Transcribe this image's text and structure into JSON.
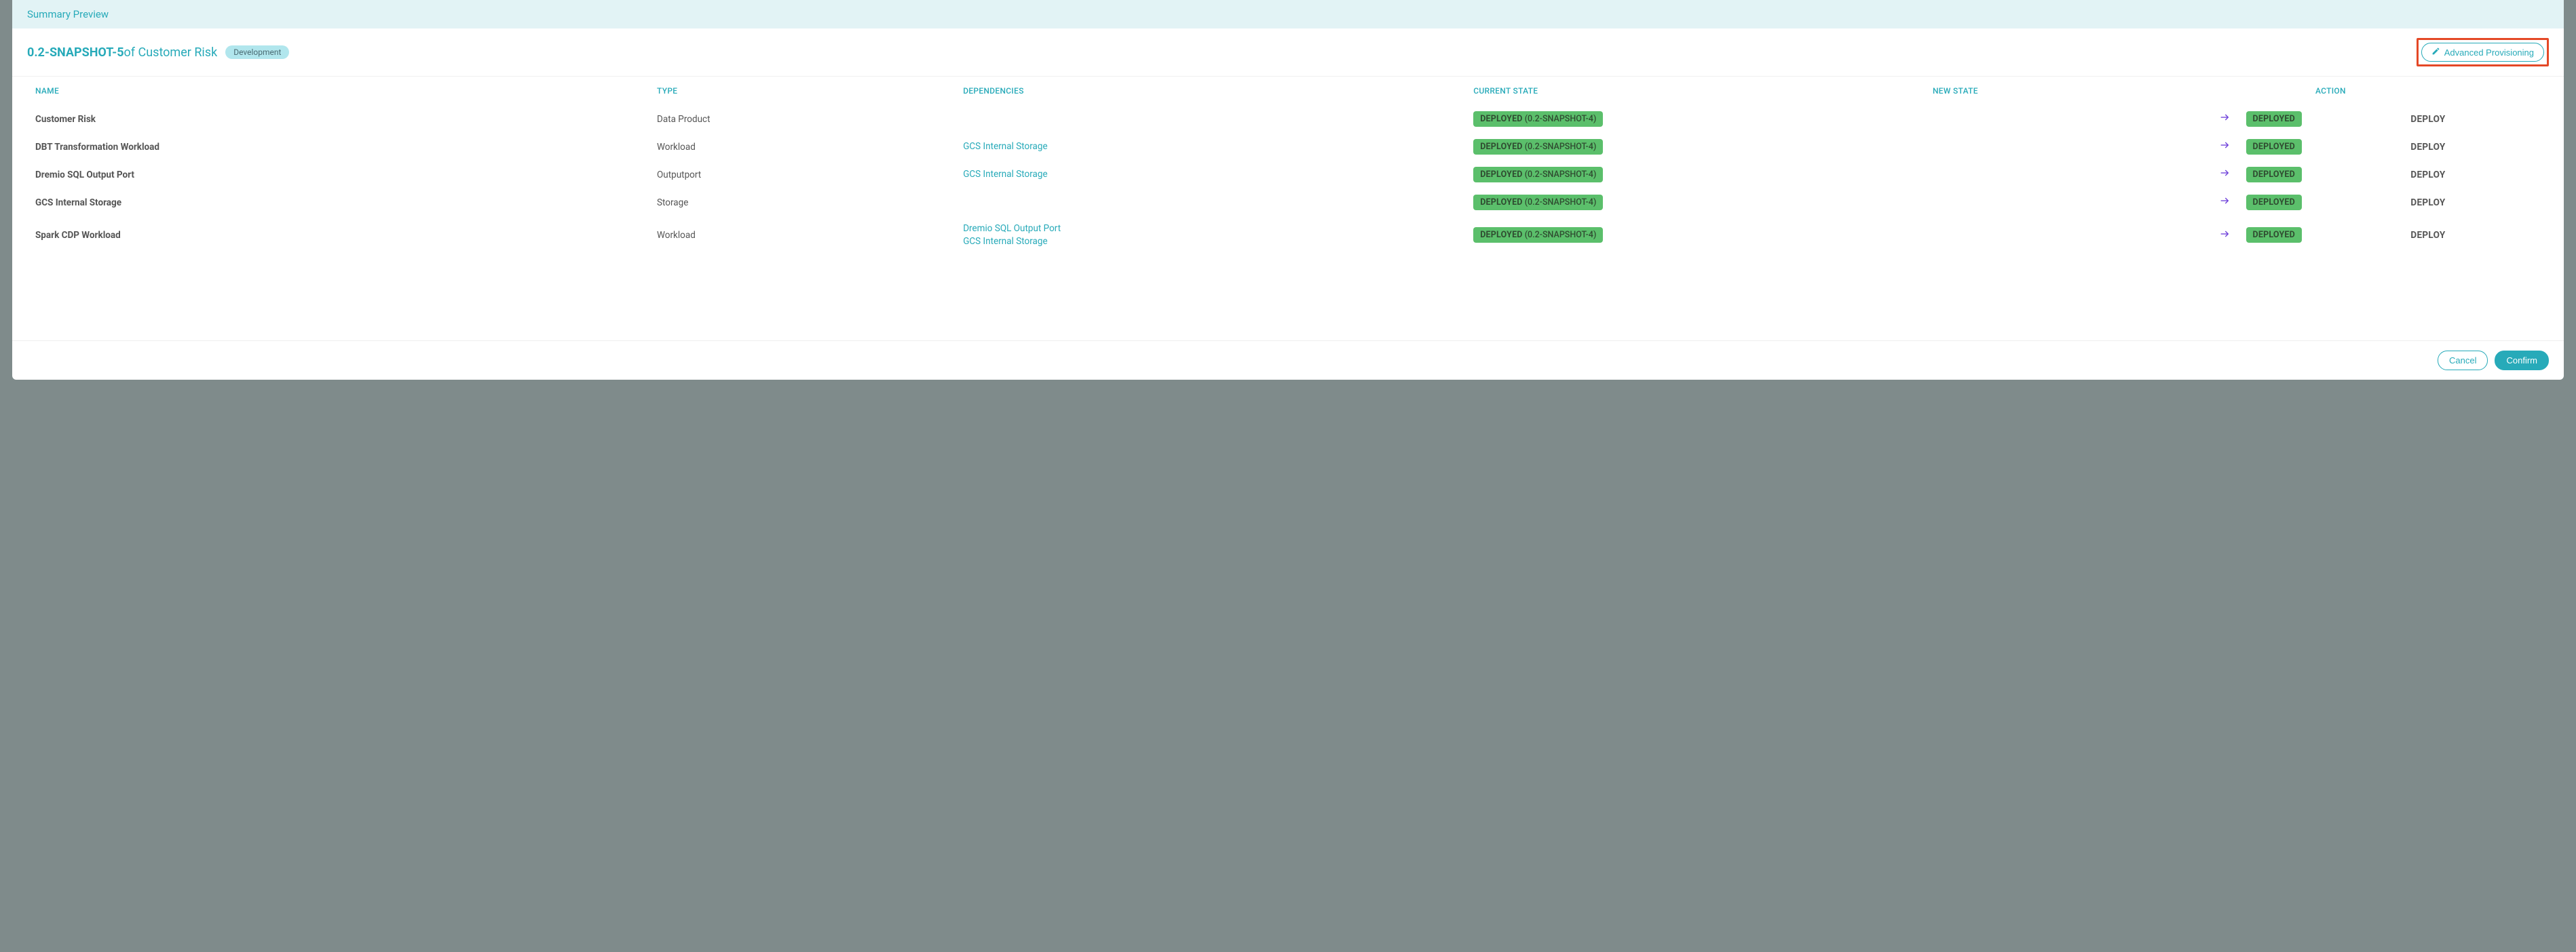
{
  "header": {
    "previewLabel": "Summary Preview",
    "snapshot": "0.2-SNAPSHOT-5",
    "ofText": " of Customer Risk",
    "envBadge": "Development",
    "advancedBtn": "Advanced Provisioning"
  },
  "columns": {
    "name": "NAME",
    "type": "TYPE",
    "dependencies": "DEPENDENCIES",
    "currentState": "CURRENT STATE",
    "newState": "NEW STATE",
    "action": "ACTION"
  },
  "rows": [
    {
      "name": "Customer Risk",
      "type": "Data Product",
      "dependencies": [],
      "currentStateLabel": "DEPLOYED",
      "currentStateVersion": "(0.2-SNAPSHOT-4)",
      "newState": "DEPLOYED",
      "action": "DEPLOY"
    },
    {
      "name": "DBT Transformation Workload",
      "type": "Workload",
      "dependencies": [
        "GCS Internal Storage"
      ],
      "currentStateLabel": "DEPLOYED",
      "currentStateVersion": "(0.2-SNAPSHOT-4)",
      "newState": "DEPLOYED",
      "action": "DEPLOY"
    },
    {
      "name": "Dremio SQL Output Port",
      "type": "Outputport",
      "dependencies": [
        "GCS Internal Storage"
      ],
      "currentStateLabel": "DEPLOYED",
      "currentStateVersion": "(0.2-SNAPSHOT-4)",
      "newState": "DEPLOYED",
      "action": "DEPLOY"
    },
    {
      "name": "GCS Internal Storage",
      "type": "Storage",
      "dependencies": [],
      "currentStateLabel": "DEPLOYED",
      "currentStateVersion": "(0.2-SNAPSHOT-4)",
      "newState": "DEPLOYED",
      "action": "DEPLOY"
    },
    {
      "name": "Spark CDP Workload",
      "type": "Workload",
      "dependencies": [
        "Dremio SQL Output Port",
        "GCS Internal Storage"
      ],
      "currentStateLabel": "DEPLOYED",
      "currentStateVersion": "(0.2-SNAPSHOT-4)",
      "newState": "DEPLOYED",
      "action": "DEPLOY"
    }
  ],
  "footer": {
    "cancel": "Cancel",
    "confirm": "Confirm"
  }
}
